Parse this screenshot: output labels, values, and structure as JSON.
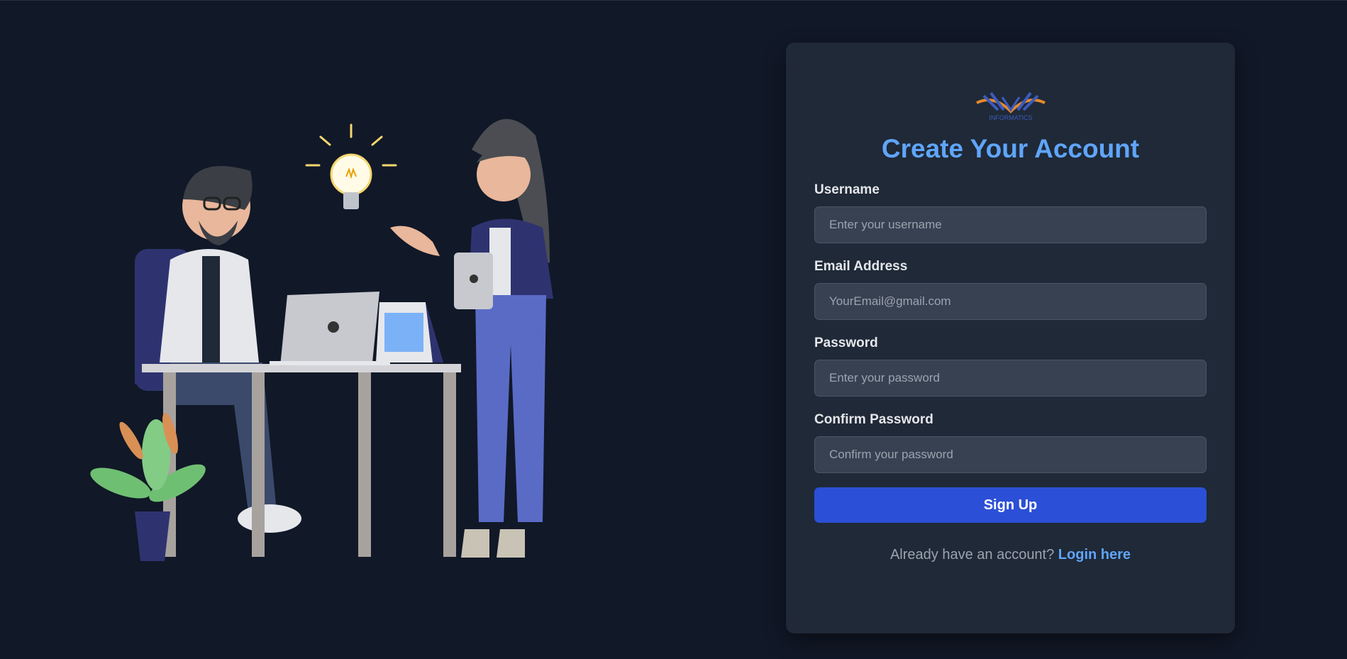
{
  "logo": {
    "text": "INFORMATICS",
    "icon": "open-book-logo"
  },
  "form": {
    "title": "Create Your Account",
    "fields": [
      {
        "label": "Username",
        "placeholder": "Enter your username",
        "value": ""
      },
      {
        "label": "Email Address",
        "placeholder": "YourEmail@gmail.com",
        "value": ""
      },
      {
        "label": "Password",
        "placeholder": "Enter your password",
        "value": ""
      },
      {
        "label": "Confirm Password",
        "placeholder": "Confirm your password",
        "value": ""
      }
    ],
    "submit_label": "Sign Up",
    "footer_text": "Already have an account?",
    "login_link": "Login here"
  },
  "colors": {
    "background": "#111827",
    "card": "#1f2937",
    "accent": "#60a5fa",
    "button": "#2b4fd6"
  }
}
